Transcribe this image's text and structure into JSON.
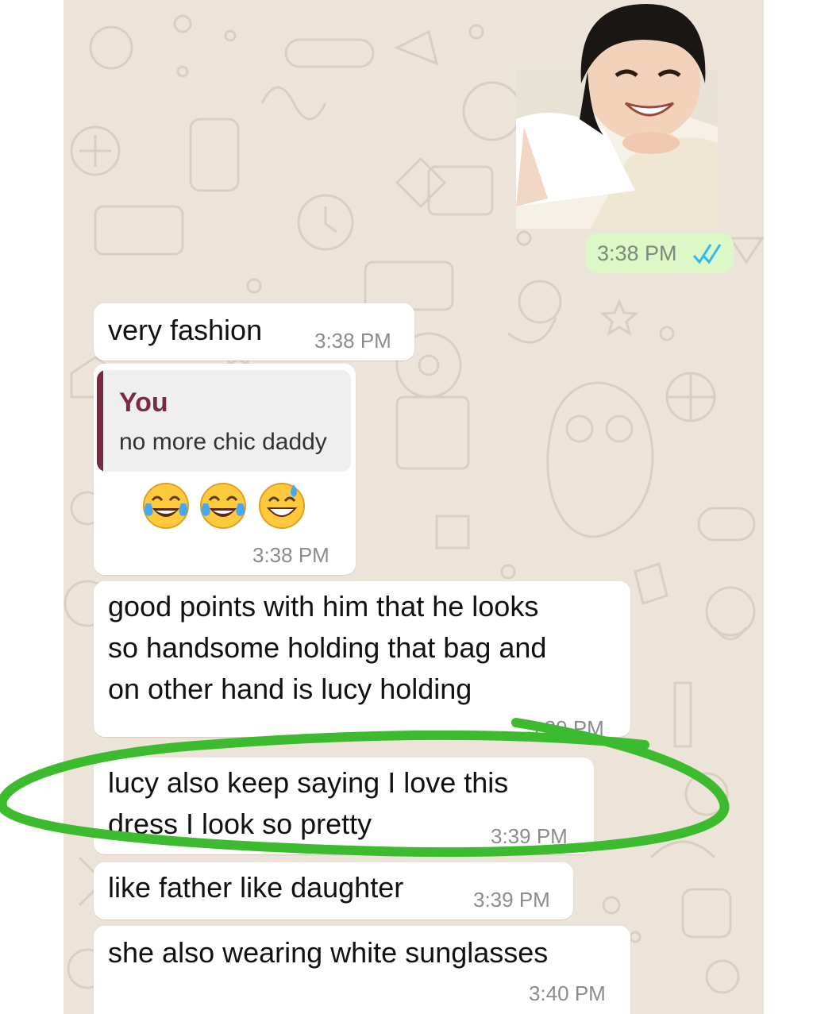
{
  "messages": {
    "photo": {
      "timestamp": "3:38 PM",
      "status_icon": "double-check-icon"
    },
    "very_fashion": {
      "text": "very fashion",
      "timestamp": "3:38 PM"
    },
    "reply": {
      "quoted_author": "You",
      "quoted_text": "no more chic daddy",
      "emojis": [
        "tears-of-joy-emoji",
        "tears-of-joy-emoji",
        "grinning-sweat-emoji"
      ],
      "timestamp": "3:38 PM"
    },
    "good_points": {
      "lines": [
        "good points with him that he looks",
        "so handsome holding that bag and",
        "on other hand is lucy holding"
      ],
      "timestamp": "3:39 PM"
    },
    "lucy_also": {
      "lines": [
        "lucy also keep saying I love this",
        "dress I look so pretty"
      ],
      "timestamp": "3:39 PM"
    },
    "like_father": {
      "text": "like father like daughter",
      "timestamp": "3:39 PM"
    },
    "sunglasses": {
      "text": "she also wearing white sunglasses",
      "timestamp": "3:40 PM"
    }
  },
  "colors": {
    "chat_background": "#ece4d8",
    "incoming_bubble": "#ffffff",
    "outgoing_bubble": "#dcf8c6",
    "quote_accent": "#7a2a42",
    "read_ticks": "#34b7f1",
    "highlight_marker": "#3dbb2e"
  }
}
